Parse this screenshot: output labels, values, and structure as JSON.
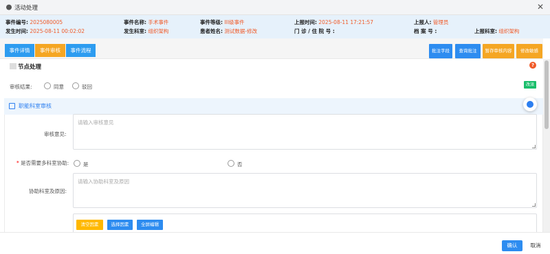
{
  "title": "活动处理",
  "close_glyph": "✕",
  "info": {
    "row1": [
      {
        "label": "事件编号:",
        "value": "2025080005"
      },
      {
        "label": "事件名称:",
        "value": "手术事件"
      },
      {
        "label": "事件等级:",
        "value": "III级事件"
      },
      {
        "label": "上报时间:",
        "value": "2025-08-11 17:21:57"
      },
      {
        "label": "上报人:",
        "value": "管理员"
      }
    ],
    "row2": [
      {
        "label": "发生时间:",
        "value": "2025-08-11 00:02:02"
      },
      {
        "label": "发生科室:",
        "value": "组织架构"
      },
      {
        "label": "患者姓名:",
        "value": "测试数据-修改"
      },
      {
        "label": "门 诊 / 住 院 号 :",
        "value": ""
      },
      {
        "label": "档 案 号 :",
        "value": ""
      },
      {
        "label": "上报科室:",
        "value": "组织架构"
      }
    ]
  },
  "tabs": [
    "事件详情",
    "事件审核",
    "事件流程"
  ],
  "toolbar_buttons": [
    "批注字段",
    "查询批注",
    "暂存审核内容",
    "修改敏感"
  ],
  "node": {
    "title": "节点处理",
    "help_glyph": "?",
    "audit_label": "审核结果:",
    "options": [
      "同意",
      "驳回"
    ],
    "change_label": "改派"
  },
  "section": {
    "title": "职能科室审核"
  },
  "form": {
    "opinion_label": "审核意见:",
    "opinion_placeholder": "请输入审核意见",
    "multi_dept_required": "*",
    "multi_dept_label": "是否需要多科室协助:",
    "multi_dept_options": [
      "是",
      "否"
    ],
    "assist_label": "协助科室及原因:",
    "assist_placeholder": "请输入协助科室及原因",
    "buttons": [
      "清空因素",
      "选择因素",
      "全屏编辑"
    ]
  },
  "footer": {
    "ok": "确认",
    "cancel": "取消"
  },
  "colors": {
    "accent": "#2d8cf0",
    "value": "#f05a28",
    "tab_active": "#f5a623",
    "success": "#19be6b"
  }
}
